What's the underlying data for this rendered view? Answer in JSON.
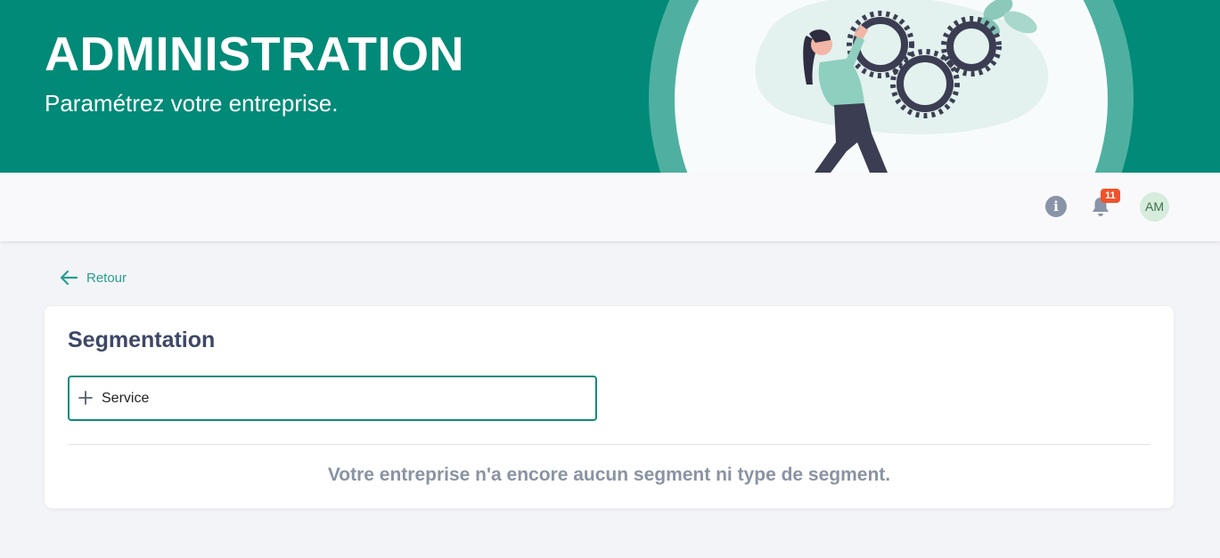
{
  "banner": {
    "title": "ADMINISTRATION",
    "subtitle": "Paramétrez votre entreprise.",
    "illustration": "person-turning-gears-illustration",
    "background_color": "#008a77"
  },
  "topbar": {
    "info_icon": "info-icon",
    "info_glyph": "i",
    "bell_icon": "bell-icon",
    "notifications_count": "11",
    "avatar_initials": "AM"
  },
  "back": {
    "icon": "arrow-left-icon",
    "label": "Retour"
  },
  "segmentation": {
    "title": "Segmentation",
    "add_icon": "plus-icon",
    "input_value": "Service",
    "empty_message": "Votre entreprise n'a encore aucun segment ni type de segment."
  },
  "colors": {
    "accent": "#008a77",
    "badge": "#f0532a",
    "heading": "#3d4766"
  }
}
